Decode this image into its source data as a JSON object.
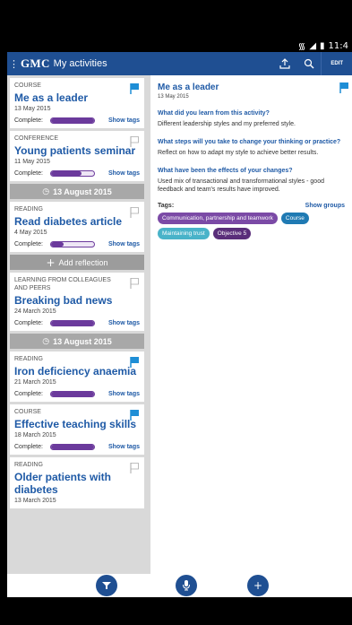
{
  "status": {
    "time": "11:4",
    "wifi_icon": "wifi-icon",
    "signal_icon": "signal-icon",
    "battery_icon": "battery-icon"
  },
  "appbar": {
    "brand": "GMC",
    "title": "My activities",
    "share_icon": "share-icon",
    "search_icon": "search-icon",
    "edit_label": "EDIT"
  },
  "list": {
    "complete_label": "Complete:",
    "show_tags_label": "Show tags",
    "add_reflection_label": "Add reflection",
    "items": [
      {
        "category": "COURSE",
        "title": "Me as a leader",
        "date": "13 May 2015",
        "progress": 1.0,
        "flag": "filled"
      },
      {
        "category": "CONFERENCE",
        "title": "Young patients seminar",
        "date": "11 May 2015",
        "progress": 0.7,
        "flag": "outline"
      },
      {
        "category": "READING",
        "title": "Read diabetes article",
        "date": "4 May 2015",
        "progress": 0.3,
        "flag": "outline"
      },
      {
        "category": "LEARNING FROM COLLEAGUES AND PEERS",
        "title": "Breaking bad news",
        "date": "24 March 2015",
        "progress": 1.0,
        "flag": "outline"
      },
      {
        "category": "READING",
        "title": "Iron deficiency anaemia",
        "date": "21 March 2015",
        "progress": 1.0,
        "flag": "filled"
      },
      {
        "category": "COURSE",
        "title": "Effective teaching skills",
        "date": "18 March 2015",
        "progress": 1.0,
        "flag": "filled"
      },
      {
        "category": "READING",
        "title": "Older patients with diabetes",
        "date": "13 March 2015",
        "progress": null,
        "flag": "outline"
      }
    ],
    "separators": [
      "13 August 2015",
      "13 August 2015"
    ]
  },
  "detail": {
    "title": "Me as a leader",
    "date": "13 May 2015",
    "qa": [
      {
        "q": "What did you learn from this activity?",
        "a": "Different leadership styles and my preferred style."
      },
      {
        "q": "What steps will you take to change your thinking or practice?",
        "a": "Reflect on how to adapt my style to achieve better results."
      },
      {
        "q": "What have been the effects of your changes?",
        "a": "Used mix of transactional and transformational styles - good feedback and team's results have improved."
      }
    ],
    "tags_label": "Tags:",
    "show_groups_label": "Show groups",
    "tags": [
      {
        "label": "Communication, partnership and teamwork",
        "color": "#7b4aa6"
      },
      {
        "label": "Course",
        "color": "#1f7ab3"
      },
      {
        "label": "Maintaining trust",
        "color": "#49b3c9"
      },
      {
        "label": "Objective 5",
        "color": "#5a2e7a"
      }
    ]
  },
  "bottombar": {
    "filter_icon": "filter-icon",
    "mic_icon": "microphone-icon",
    "add_icon": "plus-icon"
  },
  "colors": {
    "brand_blue": "#1f4f92",
    "link_blue": "#1f5aa6",
    "progress_purple": "#6b3a9c"
  }
}
